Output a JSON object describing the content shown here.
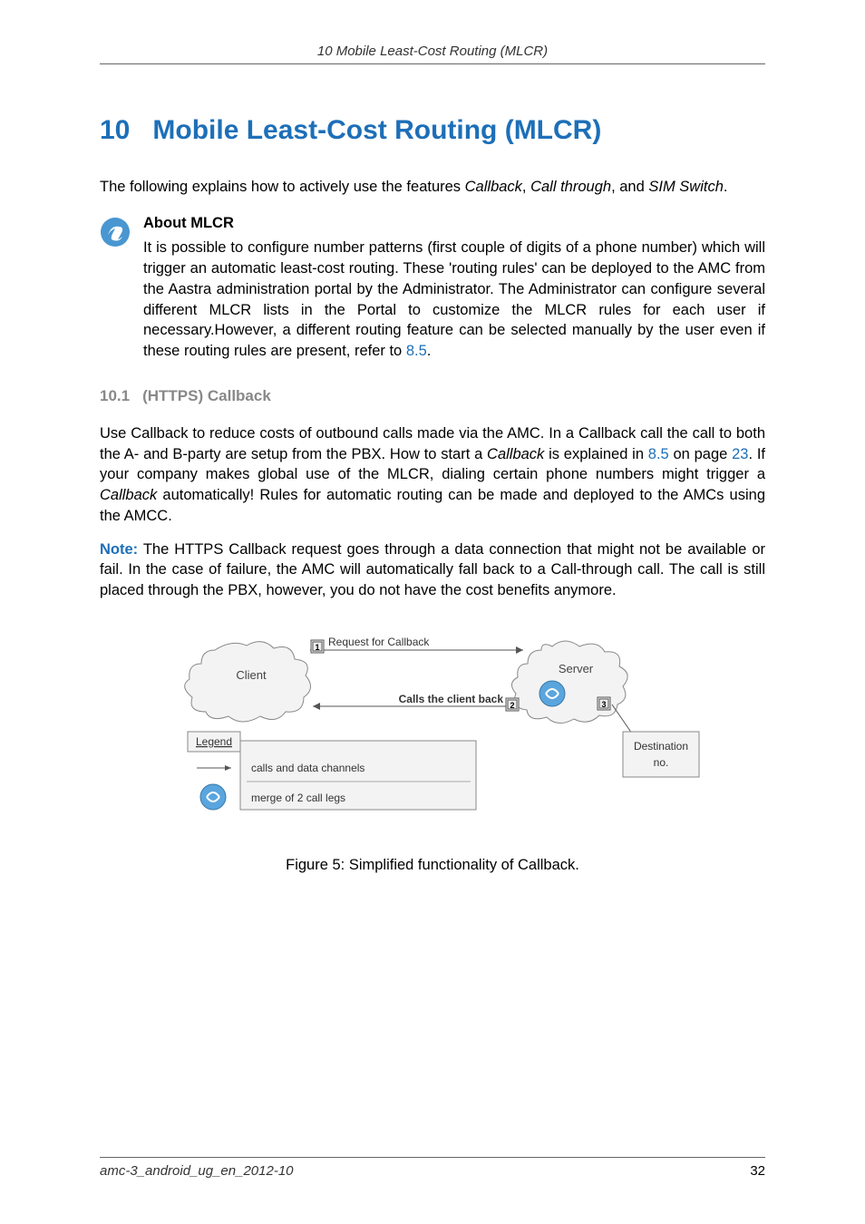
{
  "header": {
    "running_title": "10  Mobile Least-Cost Routing (MLCR)"
  },
  "chapter": {
    "number": "10",
    "title": "Mobile Least-Cost Routing (MLCR)"
  },
  "intro": {
    "prefix": "The following explains how to actively use the features ",
    "feat1": "Callback",
    "sep1": ", ",
    "feat2": "Call through",
    "sep2": ", and ",
    "feat3": "SIM Switch",
    "suffix": "."
  },
  "about": {
    "title": "About MLCR",
    "body_pre": "It is possible to configure number patterns (first couple of digits of a phone number) which will trigger an automatic least-cost routing. These 'routing rules' can be deployed to the AMC from the Aastra administration portal by the Administrator. The Administrator can configure several different MLCR lists in the Portal to customize the MLCR rules for each user if necessary.However, a different routing feature can be selected manually by the user even if these routing rules are present, refer to ",
    "body_link": "8.5",
    "body_post": "."
  },
  "subsection": {
    "number": "10.1",
    "title": "(HTTPS) Callback"
  },
  "para1": {
    "t1": "Use Callback to reduce costs of outbound calls made via the AMC. In a Callback call the call to both the A- and B-party are setup from the PBX. How to start a ",
    "i1": "Callback",
    "t2": " is explained in ",
    "l1": "8.5",
    "t3": " on page ",
    "l2": "23",
    "t4": ". If your company makes global use of the MLCR, dialing certain phone numbers might trigger a ",
    "i2": "Callback",
    "t5": " automatically! Rules for automatic routing can be made and deployed to the AMCs using the AMCC."
  },
  "para2": {
    "note": "Note:",
    "body": " The HTTPS Callback request goes through a data connection that might not be available or fail. In the case of failure, the AMC will automatically fall back to a Call-through call. The call is still placed through the PBX, however, you do not have the cost benefits anymore."
  },
  "figure": {
    "labels": {
      "request": "Request for Callback",
      "client": "Client",
      "server": "Server",
      "callsback": "Calls the client back",
      "legend": "Legend",
      "legend1": "calls and data channels",
      "legend2": "merge of 2 call legs",
      "dest1": "Destination",
      "dest2": "no.",
      "n1": "1",
      "n2": "2",
      "n3": "3"
    },
    "caption": "Figure 5: Simplified functionality of Callback."
  },
  "footer": {
    "left": "amc-3_android_ug_en_2012-10",
    "right": "32"
  }
}
